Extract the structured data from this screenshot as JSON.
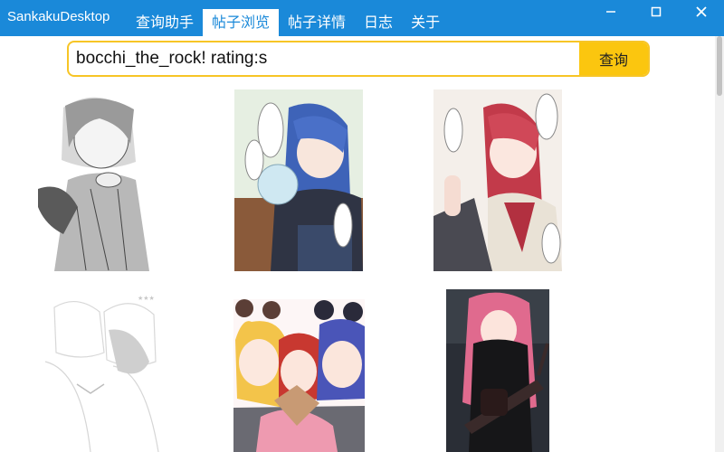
{
  "app": {
    "title": "SankakuDesktop"
  },
  "tabs": [
    {
      "label": "查询助手"
    },
    {
      "label": "帖子浏览",
      "active": true
    },
    {
      "label": "帖子详情"
    },
    {
      "label": "日志"
    },
    {
      "label": "关于"
    }
  ],
  "search": {
    "value": "bocchi_the_rock! rating:s",
    "button_label": "查询"
  },
  "colors": {
    "titlebar": "#1a89d9",
    "accent": "#fbc60f",
    "search_border": "#f7c526"
  },
  "icons": [
    "minimize-icon",
    "maximize-icon",
    "close-icon"
  ],
  "posts": [
    {
      "description": "monochrome sketch"
    },
    {
      "description": "blue hair girl on bench"
    },
    {
      "description": "red hair girl with speech bubbles"
    },
    {
      "description": "faint pencil sketch"
    },
    {
      "description": "three girls group"
    },
    {
      "description": "pink hair girl with guitar"
    }
  ]
}
